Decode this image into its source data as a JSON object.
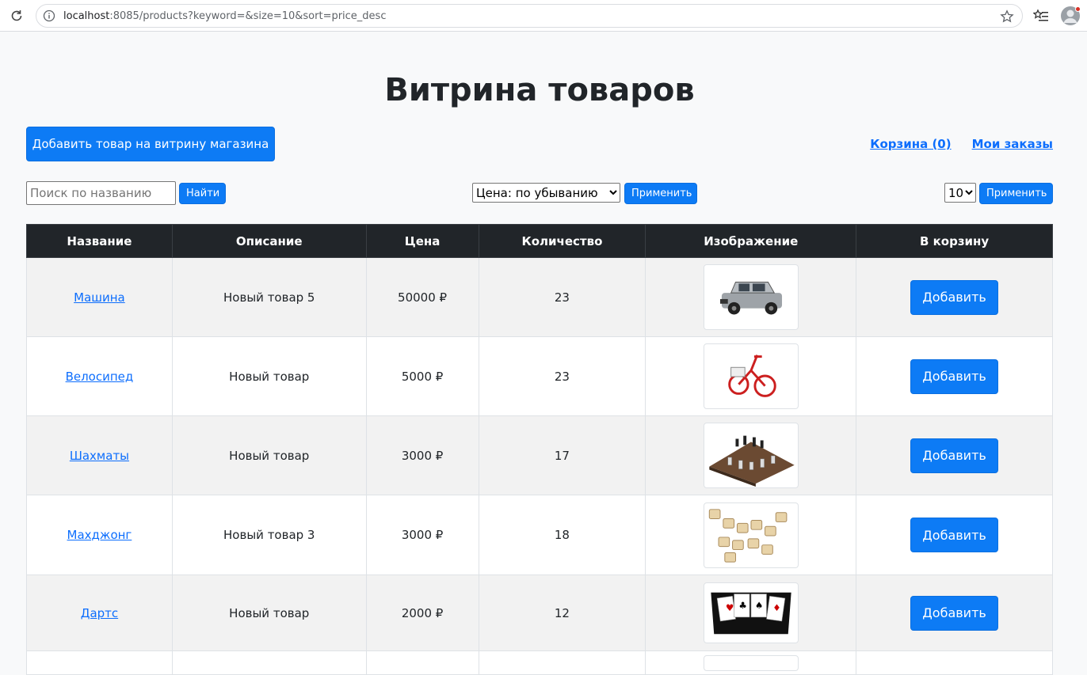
{
  "browser": {
    "url_host": "localhost",
    "url_rest": ":8085/products?keyword=&size=10&sort=price_desc"
  },
  "header": {
    "title": "Витрина товаров",
    "add_product_label": "Добавить товар на витрину магазина",
    "cart_link": "Корзина (0)",
    "orders_link": "Мои заказы"
  },
  "filters": {
    "search_placeholder": "Поиск по названию",
    "search_value": "",
    "find_label": "Найти",
    "sort_selected": "Цена: по убыванию",
    "sort_apply_label": "Применить",
    "size_selected": "10",
    "size_apply_label": "Применить"
  },
  "table": {
    "columns": [
      "Название",
      "Описание",
      "Цена",
      "Количество",
      "Изображение",
      "В корзину"
    ],
    "add_label": "Добавить",
    "rows": [
      {
        "name": "Машина",
        "description": "Новый товар 5",
        "price": "50000 ₽",
        "quantity": "23",
        "image": "jeep-image"
      },
      {
        "name": "Велосипед",
        "description": "Новый товар",
        "price": "5000 ₽",
        "quantity": "23",
        "image": "tricycle-image"
      },
      {
        "name": "Шахматы",
        "description": "Новый товар",
        "price": "3000 ₽",
        "quantity": "17",
        "image": "chess-image"
      },
      {
        "name": "Махджонг",
        "description": "Новый товар 3",
        "price": "3000 ₽",
        "quantity": "18",
        "image": "tiles-image"
      },
      {
        "name": "Дартс",
        "description": "Новый товар",
        "price": "2000 ₽",
        "quantity": "12",
        "image": "cards-image"
      }
    ]
  }
}
